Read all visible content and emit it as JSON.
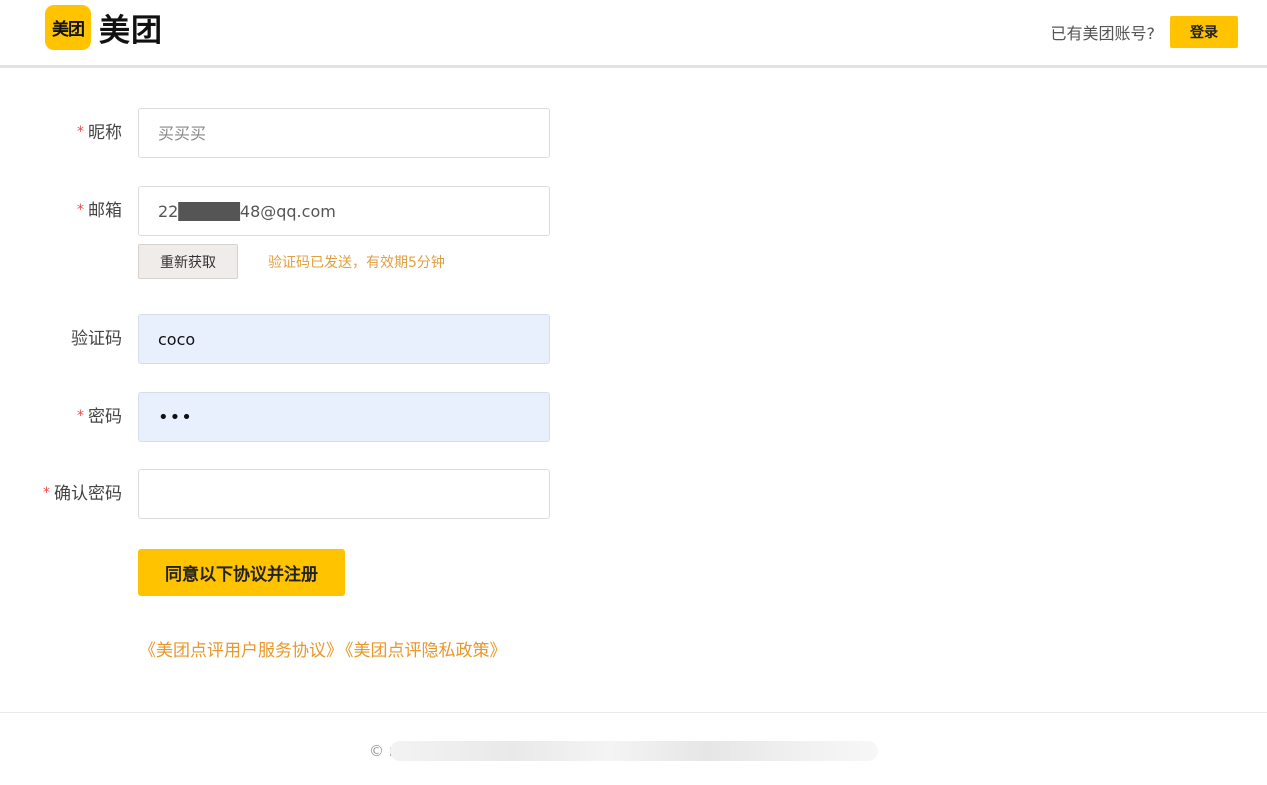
{
  "header": {
    "logo_badge": "美团",
    "logo_text": "美团",
    "have_account": "已有美团账号?",
    "login_label": "登录",
    "accent_color": "#ffc300"
  },
  "form": {
    "nickname": {
      "label": "昵称",
      "required": true,
      "value": "",
      "placeholder": "买买买"
    },
    "email": {
      "label": "邮箱",
      "required": true,
      "value": "22█████48@qq.com",
      "masked": true
    },
    "resend_label": "重新获取",
    "code_sent_hint": "验证码已发送，有效期5分钟",
    "code": {
      "label": "验证码",
      "required": false,
      "value": "coco"
    },
    "password": {
      "label": "密码",
      "required": true,
      "value": "•••"
    },
    "confirm_password": {
      "label": "确认密码",
      "required": true,
      "value": ""
    },
    "submit_label": "同意以下协议并注册",
    "required_marker": "*"
  },
  "agreements": {
    "service": "《美团点评用户服务协议》",
    "privacy": "《美团点评隐私政策》",
    "link_color": "#e8972a"
  },
  "footer": {
    "copyright_prefix": "© r"
  }
}
